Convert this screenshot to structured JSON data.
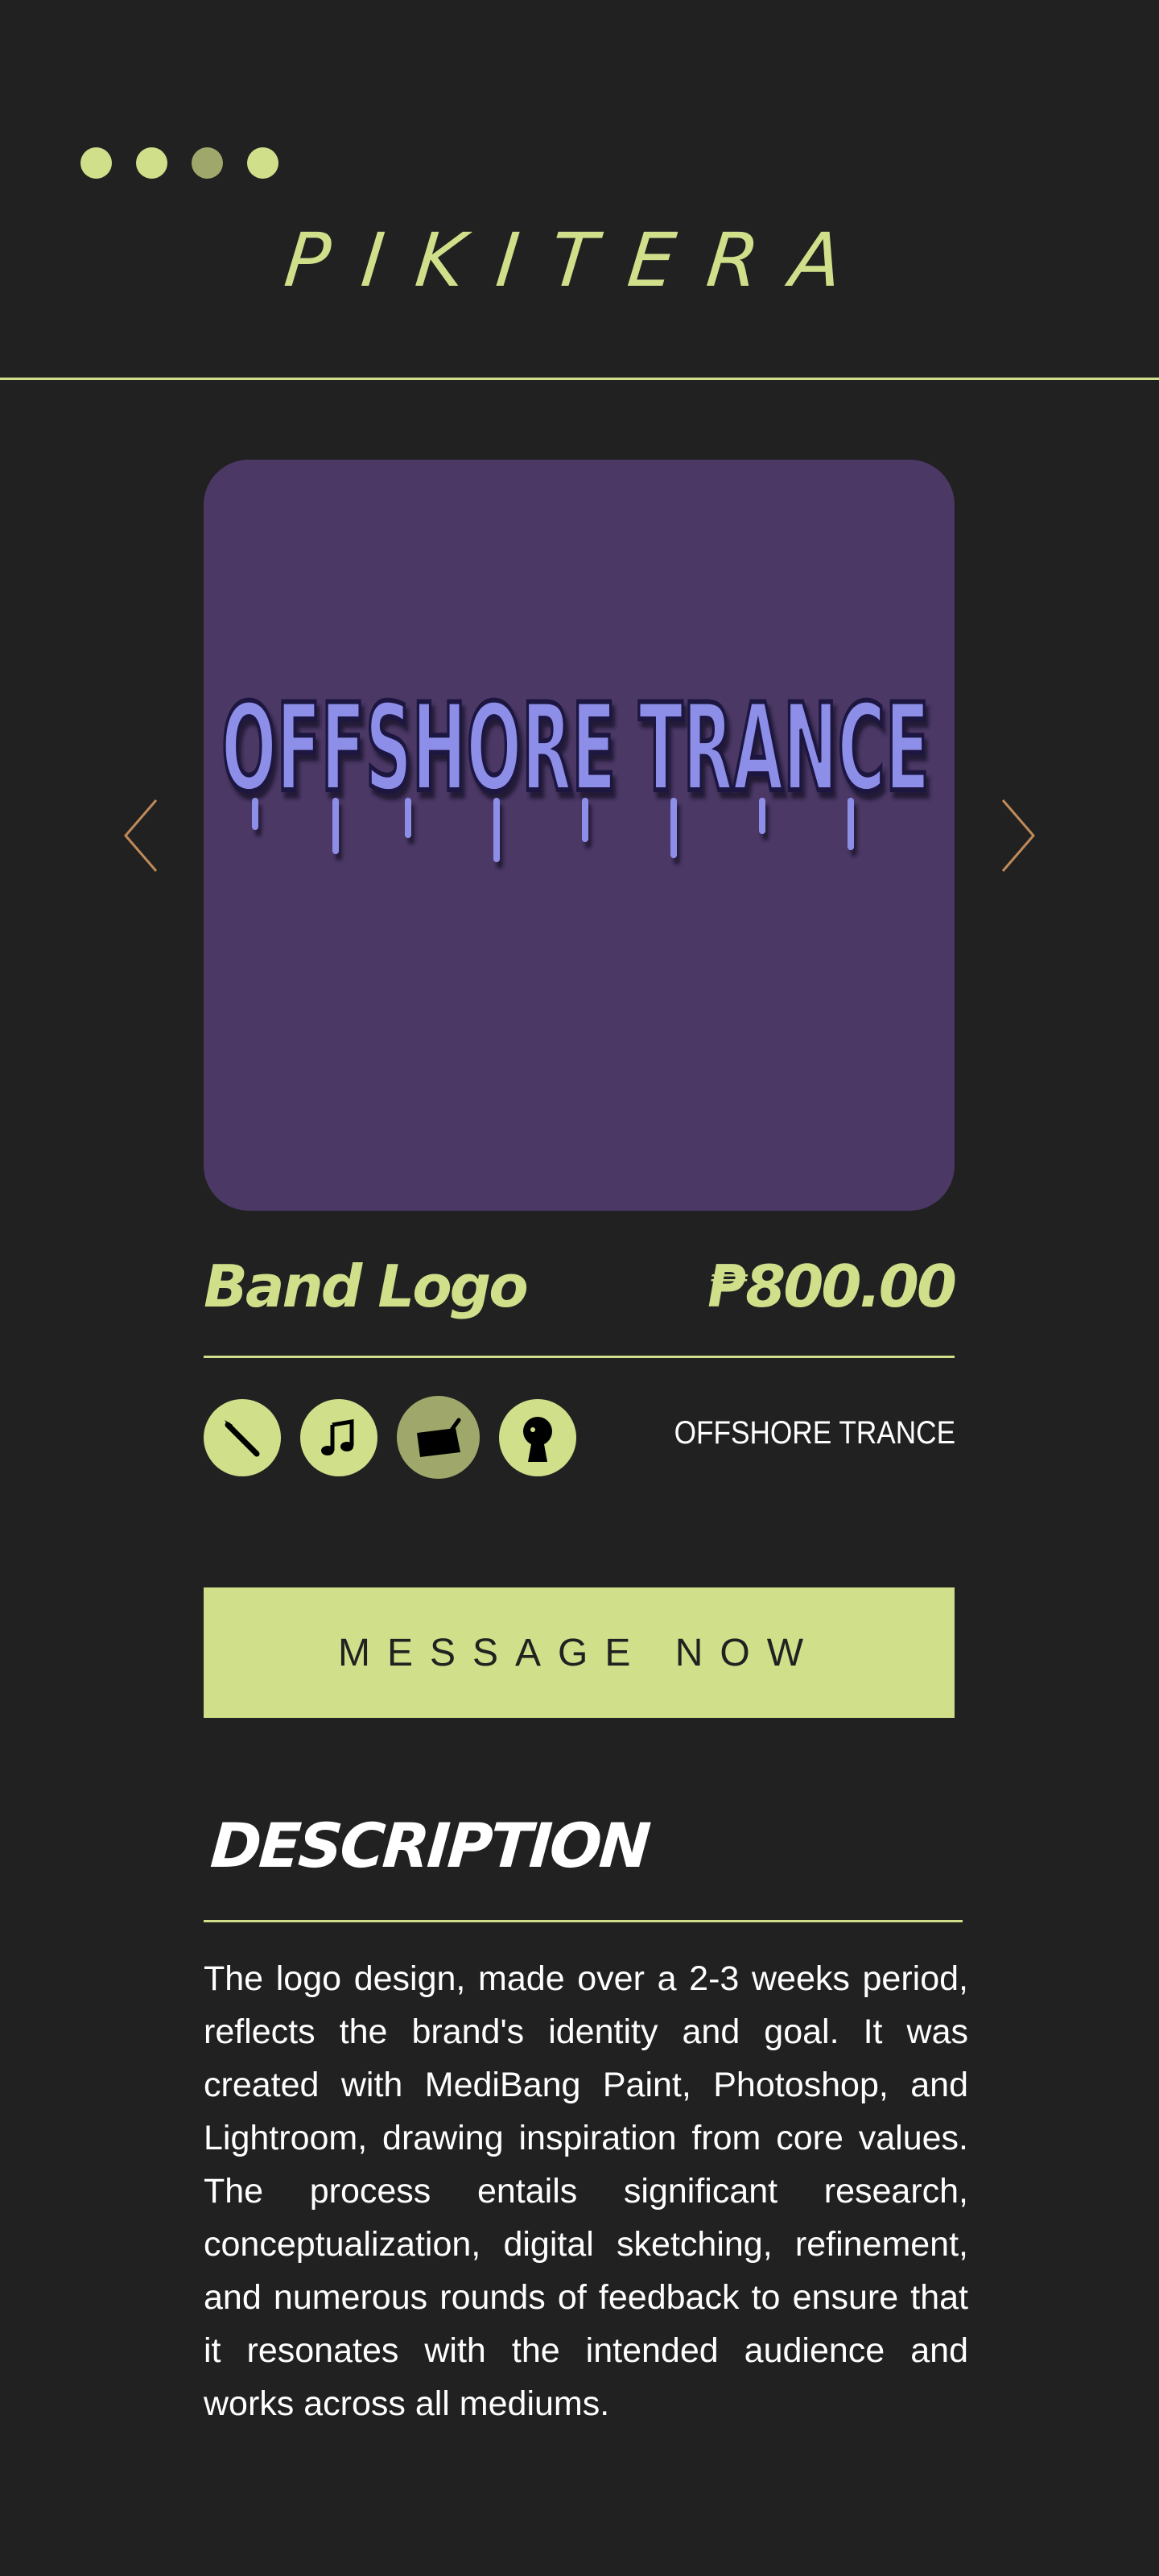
{
  "header": {
    "brand": "PIKITERA",
    "dots_icon": "carousel-dots-icon"
  },
  "product": {
    "image_alt": "OFFSHORE TRANCE",
    "title": "Band Logo",
    "price": "₱800.00",
    "tag": "OFFSHORE TRANCE",
    "tool_icons": [
      "brush-icon",
      "music-note-icon",
      "drawing-tablet-icon",
      "avatar-icon"
    ]
  },
  "actions": {
    "message_label": "MESSAGE NOW"
  },
  "description": {
    "heading": "DESCRIPTION",
    "body": "The logo design, made over a 2-3 weeks period, reflects the brand's identity and goal. It was created with MediBang Paint, Photoshop, and Lightroom, drawing inspiration from core values. The process entails significant research, conceptualization, digital sketching, refinement, and numerous rounds of feedback to ensure that it resonates with the intended audience and works across all mediums."
  },
  "colors": {
    "background": "#212121",
    "accent": "#cfdf8a",
    "accent_dim": "#9fa86a",
    "hero_bg": "#4b3865",
    "logo_fill": "#8d8ee8",
    "arrow": "#c08a5a"
  }
}
